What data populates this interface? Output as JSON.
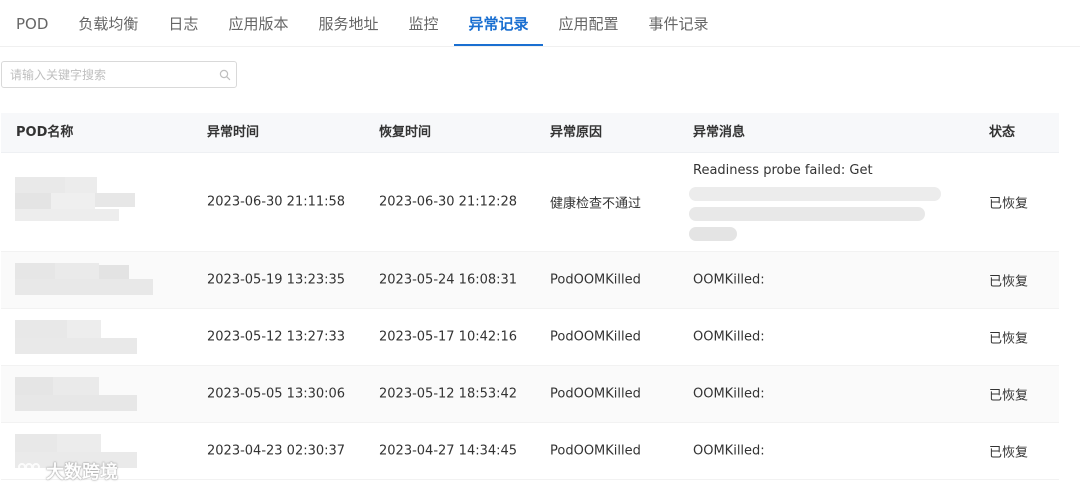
{
  "tabs": [
    {
      "label": "POD",
      "active": false
    },
    {
      "label": "负载均衡",
      "active": false
    },
    {
      "label": "日志",
      "active": false
    },
    {
      "label": "应用版本",
      "active": false
    },
    {
      "label": "服务地址",
      "active": false
    },
    {
      "label": "监控",
      "active": false
    },
    {
      "label": "异常记录",
      "active": true
    },
    {
      "label": "应用配置",
      "active": false
    },
    {
      "label": "事件记录",
      "active": false
    }
  ],
  "search": {
    "placeholder": "请输入关键字搜索",
    "value": "",
    "icon": "search-icon"
  },
  "table": {
    "headers": {
      "pod_name": "POD名称",
      "start_time": "异常时间",
      "end_time": "恢复时间",
      "reason": "异常原因",
      "message": "异常消息",
      "status": "状态"
    },
    "rows": [
      {
        "pod_name": "",
        "start_time": "2023-06-30 21:11:58",
        "end_time": "2023-06-30 21:12:28",
        "reason": "健康检查不通过",
        "message": "Readiness probe failed: Get",
        "status": "已恢复"
      },
      {
        "pod_name": "",
        "start_time": "2023-05-19 13:23:35",
        "end_time": "2023-05-24 16:08:31",
        "reason": "PodOOMKilled",
        "message": "OOMKilled:",
        "status": "已恢复"
      },
      {
        "pod_name": "",
        "start_time": "2023-05-12 13:27:33",
        "end_time": "2023-05-17 10:42:16",
        "reason": "PodOOMKilled",
        "message": "OOMKilled:",
        "status": "已恢复"
      },
      {
        "pod_name": "",
        "start_time": "2023-05-05 13:30:06",
        "end_time": "2023-05-12 18:53:42",
        "reason": "PodOOMKilled",
        "message": "OOMKilled:",
        "status": "已恢复"
      },
      {
        "pod_name": "",
        "start_time": "2023-04-23 02:30:37",
        "end_time": "2023-04-27 14:34:45",
        "reason": "PodOOMKilled",
        "message": "OOMKilled:",
        "status": "已恢复"
      }
    ]
  },
  "watermark": {
    "text": "大数跨境"
  },
  "colors": {
    "accent": "#1a6fd1",
    "header_bg": "#f7f8fa",
    "alt_row_bg": "#fafafa"
  }
}
